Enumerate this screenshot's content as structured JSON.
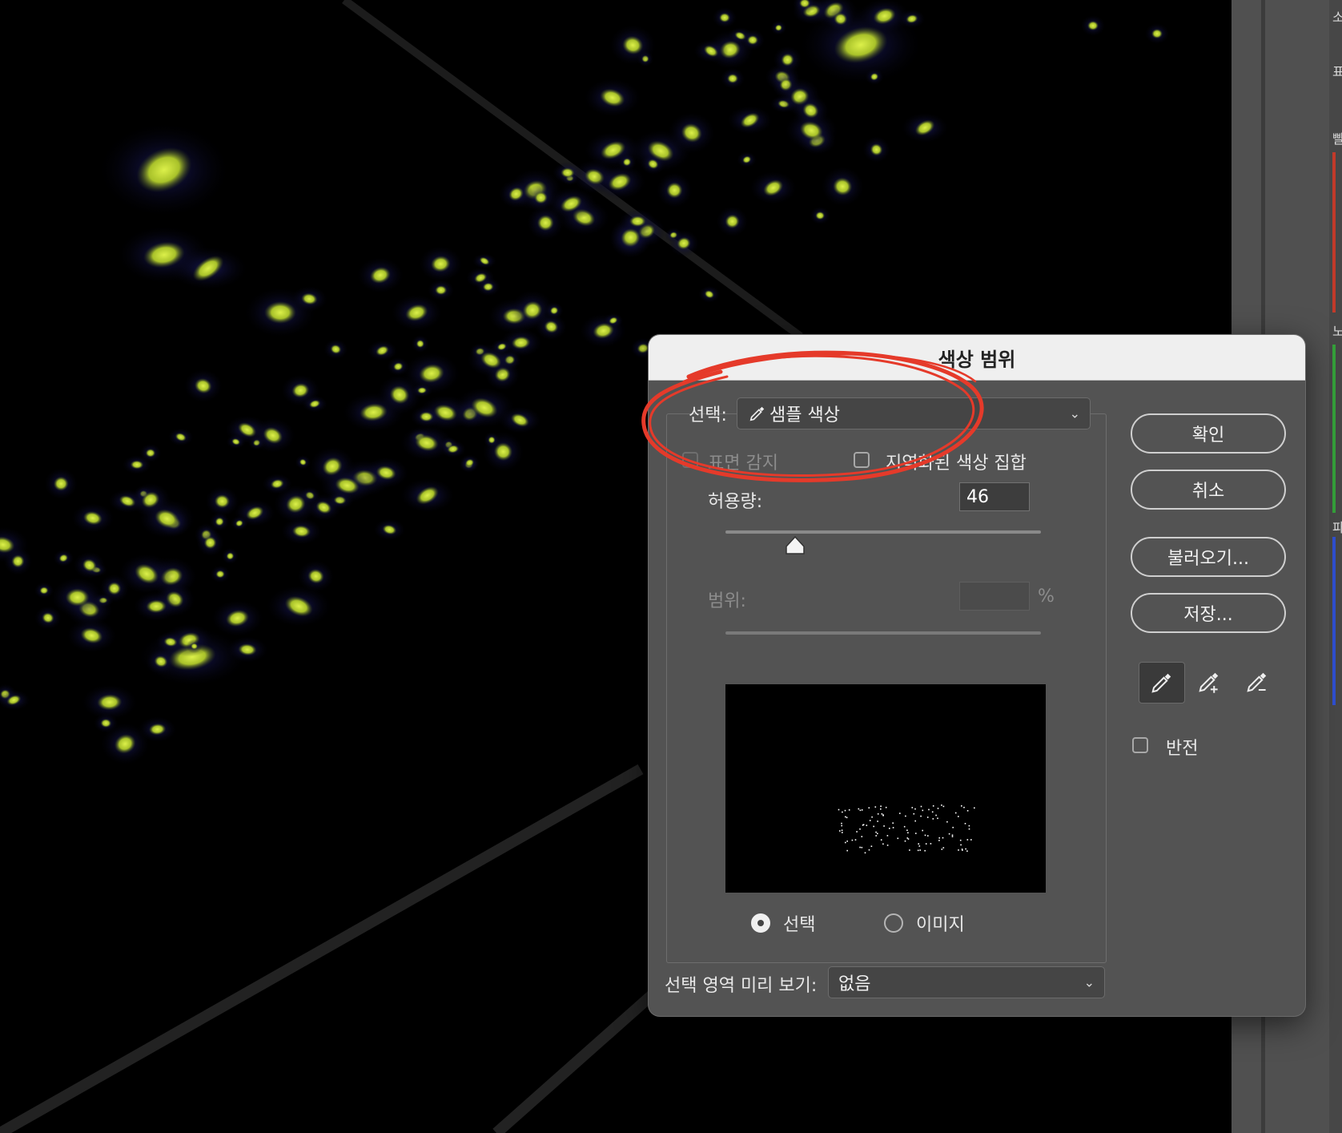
{
  "dialog": {
    "title": "색상 범위",
    "select_label": "선택:",
    "select_value": "샘플 색상",
    "face_detect_label": "표면 감지",
    "localized_label": "지역화된 색상 집합",
    "fuzziness_label": "허용량:",
    "fuzziness_value": "46",
    "fuzziness_fraction": 0.22,
    "range_label": "범위:",
    "range_value": "",
    "range_unit": "%",
    "view_selection_label": "선택",
    "view_image_label": "이미지",
    "view_selected": "selection",
    "preview_label": "선택 영역 미리 보기:",
    "preview_value": "없음"
  },
  "buttons": {
    "ok": "확인",
    "cancel": "취소",
    "load": "불러오기...",
    "save": "저장..."
  },
  "tools": [
    {
      "icon": "eyedropper-icon",
      "active": true
    },
    {
      "icon": "eyedropper-plus-icon",
      "active": false
    },
    {
      "icon": "eyedropper-minus-icon",
      "active": false
    }
  ],
  "invert_label": "반전",
  "colors": {
    "annotation": "#e53a2a",
    "highlight": "#c8e42a"
  },
  "right_edge_glyphs": [
    "소",
    "표",
    "빨",
    "노",
    "파"
  ]
}
